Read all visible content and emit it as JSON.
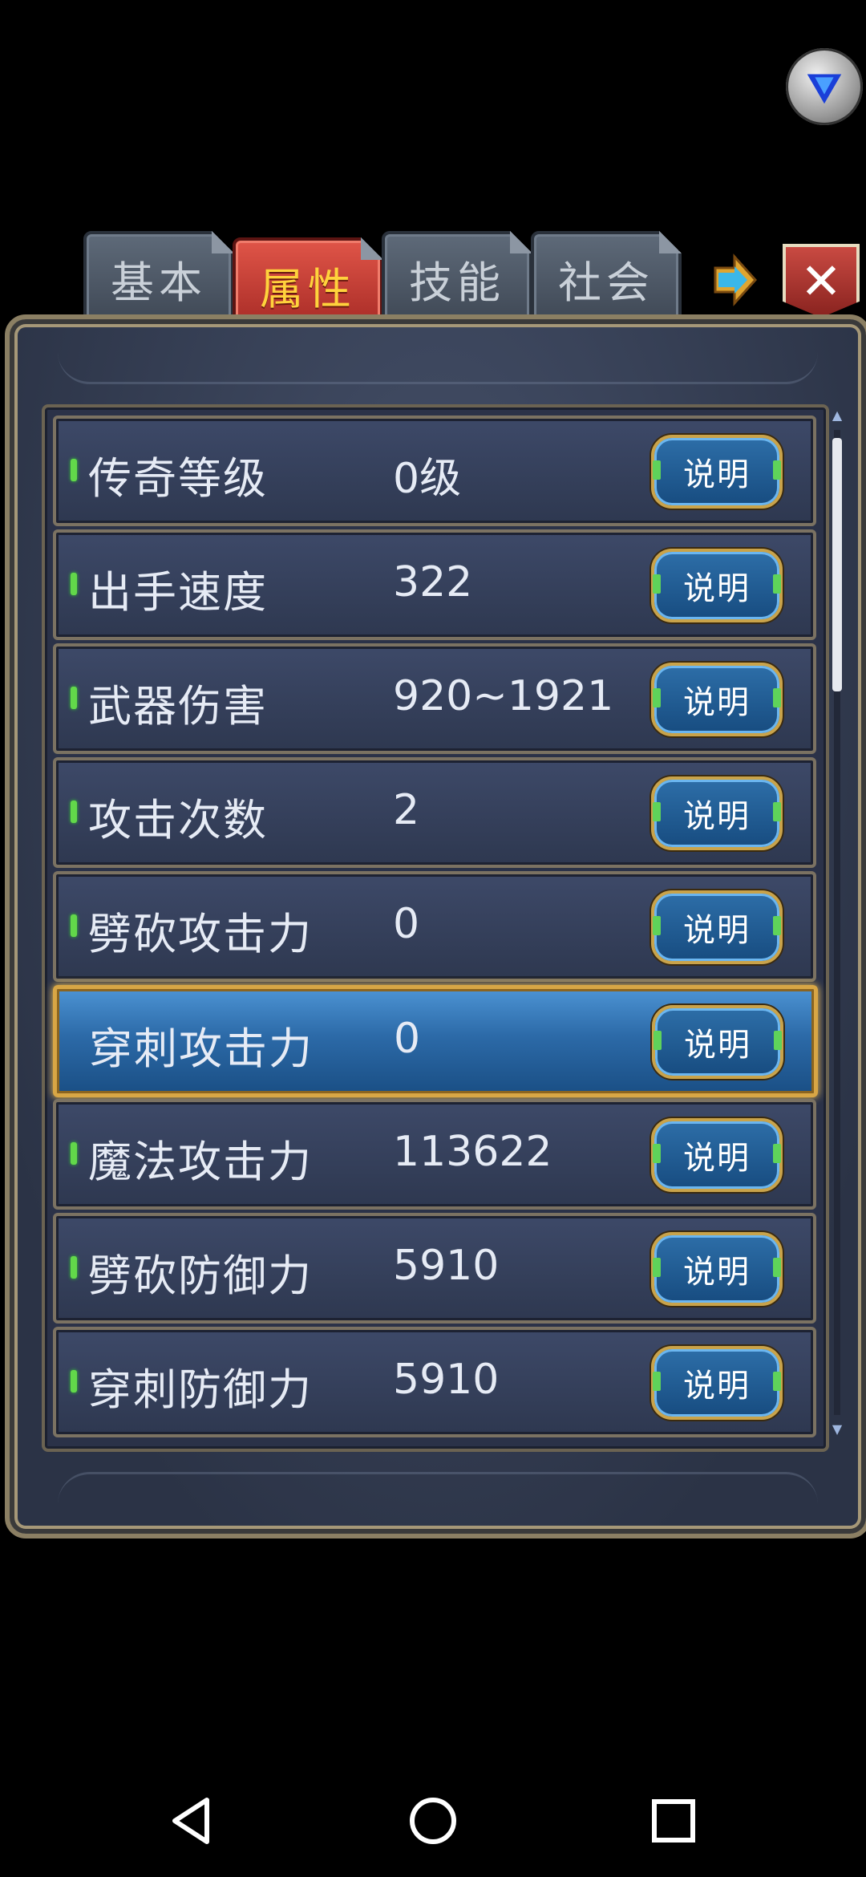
{
  "tabs": [
    {
      "label": "基本",
      "active": false
    },
    {
      "label": "属性",
      "active": true
    },
    {
      "label": "技能",
      "active": false
    },
    {
      "label": "社会",
      "active": false
    }
  ],
  "close_label": "✕",
  "attributes": [
    {
      "label": "传奇等级",
      "value": "0级",
      "button": "说明",
      "selected": false
    },
    {
      "label": "出手速度",
      "value": "322",
      "button": "说明",
      "selected": false
    },
    {
      "label": "武器伤害",
      "value": "920~1921",
      "button": "说明",
      "selected": false
    },
    {
      "label": "攻击次数",
      "value": "2",
      "button": "说明",
      "selected": false
    },
    {
      "label": "劈砍攻击力",
      "value": "0",
      "button": "说明",
      "selected": false
    },
    {
      "label": "穿刺攻击力",
      "value": "0",
      "button": "说明",
      "selected": true
    },
    {
      "label": "魔法攻击力",
      "value": "113622",
      "button": "说明",
      "selected": false
    },
    {
      "label": "劈砍防御力",
      "value": "5910",
      "button": "说明",
      "selected": false
    },
    {
      "label": "穿刺防御力",
      "value": "5910",
      "button": "说明",
      "selected": false
    }
  ],
  "scroll": {
    "position_fraction": 0.0
  },
  "icons": {
    "overlay": "v-logo-icon",
    "next": "arrow-right-icon",
    "close": "close-icon",
    "nav": [
      "back-icon",
      "home-icon",
      "recents-icon"
    ]
  }
}
